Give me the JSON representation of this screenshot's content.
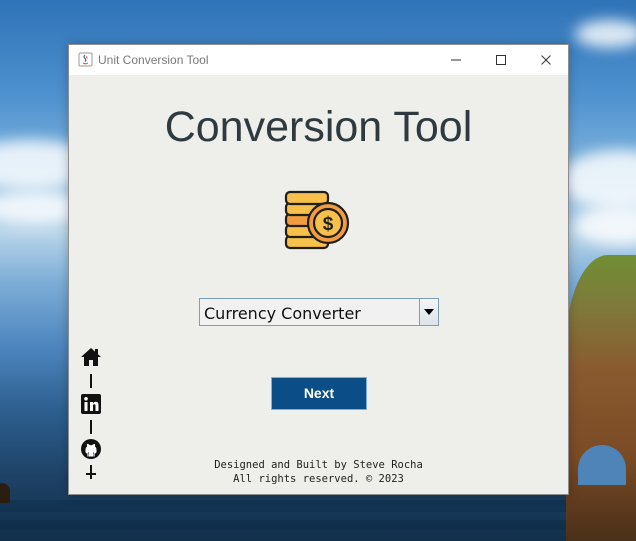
{
  "window": {
    "title": "Unit Conversion Tool"
  },
  "main": {
    "heading": "Conversion Tool",
    "illustration": "coin-stack-dollar-icon",
    "converter_select": {
      "selected": "Currency Converter"
    },
    "next_label": "Next"
  },
  "social_links": [
    {
      "icon": "home-icon"
    },
    {
      "icon": "linkedin-icon"
    },
    {
      "icon": "github-icon"
    }
  ],
  "footer": {
    "line1": "Designed and Built by Steve Rocha",
    "line2": "All rights reserved. © 2023"
  },
  "colors": {
    "window_bg": "#eeeeea",
    "heading": "#2f3a40",
    "button_bg": "#0b4d86",
    "button_text": "#ffffff",
    "coin_gold": "#f7c04a",
    "coin_orange": "#f39c3d"
  }
}
